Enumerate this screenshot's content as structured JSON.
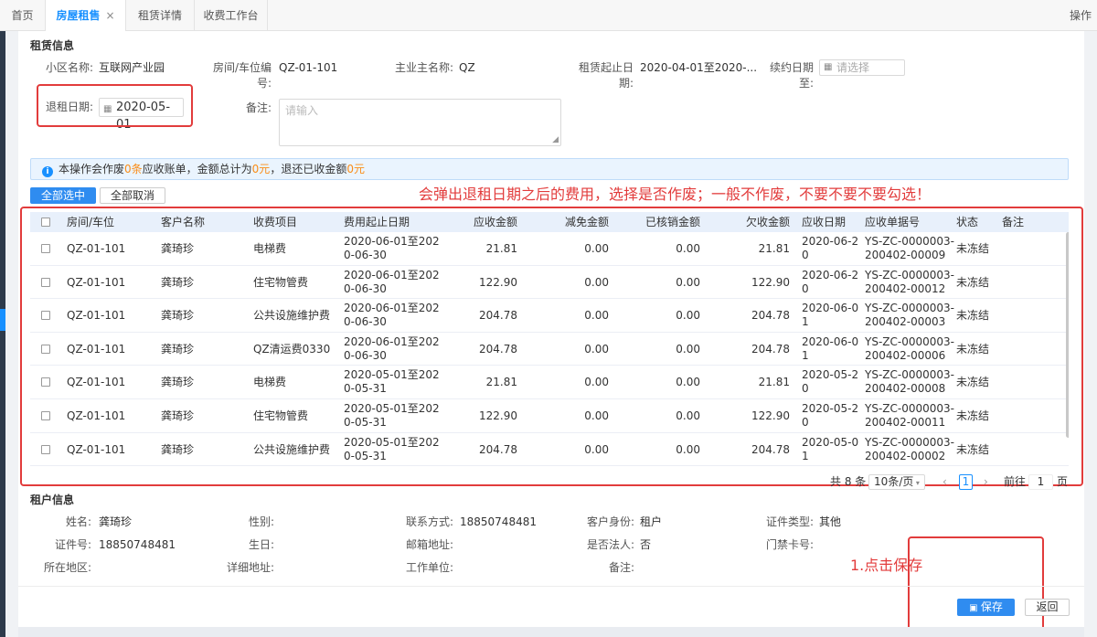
{
  "tabs": {
    "home": "首页",
    "housing": "房屋租售",
    "close": "×",
    "lease_detail": "租赁详情",
    "cashier": "收费工作台",
    "ops": "操作"
  },
  "lease": {
    "title": "租赁信息",
    "community_label": "小区名称:",
    "community_value": "互联网产业园",
    "room_label_1": "房间/车位编",
    "room_label_2": "号:",
    "room_value": "QZ-01-101",
    "owner_label": "主业主名称:",
    "owner_value": "QZ",
    "period_label_1": "租赁起止日",
    "period_label_2": "期:",
    "period_value": "2020-04-01至2020-...",
    "renew_label": "续约日期至:",
    "renew_placeholder": "请选择",
    "checkout_label": "退租日期:",
    "checkout_value": "2020-05-01",
    "remark_label": "备注:",
    "remark_placeholder": "请输入"
  },
  "alert": {
    "icon": "i",
    "p1": "本操作会作废",
    "count": "0条",
    "p2": "应收账单，金额总计为",
    "amount": "0元",
    "p3": "，退还已收金额",
    "refund": "0元"
  },
  "buttons": {
    "select_all": "全部选中",
    "cancel_all": "全部取消",
    "save": "保存",
    "back": "返回"
  },
  "annotations": {
    "top": "会弹出退租日期之后的费用，选择是否作废；一般不作废，不要不要不要勾选！",
    "save": "1.点击保存"
  },
  "table": {
    "headers": [
      "房间/车位",
      "客户名称",
      "收费项目",
      "费用起止日期",
      "应收金额",
      "减免金额",
      "已核销金额",
      "欠收金额",
      "应收日期",
      "应收单据号",
      "状态",
      "备注"
    ],
    "rows": [
      {
        "room": "QZ-01-101",
        "customer": "龚琦珍",
        "item": "电梯费",
        "period1": "2020-06-01至202",
        "period2": "0-06-30",
        "due": "21.81",
        "discount": "0.00",
        "verified": "0.00",
        "owed": "21.81",
        "date1": "2020-06-2",
        "date2": "0",
        "doc1": "YS-ZC-0000003-",
        "doc2": "200402-00009",
        "status": "未冻结"
      },
      {
        "room": "QZ-01-101",
        "customer": "龚琦珍",
        "item": "住宅物管费",
        "period1": "2020-06-01至202",
        "period2": "0-06-30",
        "due": "122.90",
        "discount": "0.00",
        "verified": "0.00",
        "owed": "122.90",
        "date1": "2020-06-2",
        "date2": "0",
        "doc1": "YS-ZC-0000003-",
        "doc2": "200402-00012",
        "status": "未冻结"
      },
      {
        "room": "QZ-01-101",
        "customer": "龚琦珍",
        "item": "公共设施维护费",
        "period1": "2020-06-01至202",
        "period2": "0-06-30",
        "due": "204.78",
        "discount": "0.00",
        "verified": "0.00",
        "owed": "204.78",
        "date1": "2020-06-0",
        "date2": "1",
        "doc1": "YS-ZC-0000003-",
        "doc2": "200402-00003",
        "status": "未冻结"
      },
      {
        "room": "QZ-01-101",
        "customer": "龚琦珍",
        "item": "QZ清运费0330",
        "period1": "2020-06-01至202",
        "period2": "0-06-30",
        "due": "204.78",
        "discount": "0.00",
        "verified": "0.00",
        "owed": "204.78",
        "date1": "2020-06-0",
        "date2": "1",
        "doc1": "YS-ZC-0000003-",
        "doc2": "200402-00006",
        "status": "未冻结"
      },
      {
        "room": "QZ-01-101",
        "customer": "龚琦珍",
        "item": "电梯费",
        "period1": "2020-05-01至202",
        "period2": "0-05-31",
        "due": "21.81",
        "discount": "0.00",
        "verified": "0.00",
        "owed": "21.81",
        "date1": "2020-05-2",
        "date2": "0",
        "doc1": "YS-ZC-0000003-",
        "doc2": "200402-00008",
        "status": "未冻结"
      },
      {
        "room": "QZ-01-101",
        "customer": "龚琦珍",
        "item": "住宅物管费",
        "period1": "2020-05-01至202",
        "period2": "0-05-31",
        "due": "122.90",
        "discount": "0.00",
        "verified": "0.00",
        "owed": "122.90",
        "date1": "2020-05-2",
        "date2": "0",
        "doc1": "YS-ZC-0000003-",
        "doc2": "200402-00011",
        "status": "未冻结"
      },
      {
        "room": "QZ-01-101",
        "customer": "龚琦珍",
        "item": "公共设施维护费",
        "period1": "2020-05-01至202",
        "period2": "0-05-31",
        "due": "204.78",
        "discount": "0.00",
        "verified": "0.00",
        "owed": "204.78",
        "date1": "2020-05-0",
        "date2": "1",
        "doc1": "YS-ZC-0000003-",
        "doc2": "200402-00002",
        "status": "未冻结"
      }
    ]
  },
  "pager": {
    "total": "共 8 条",
    "page_size": "10条/页",
    "prev": "‹",
    "current": "1",
    "next": "›",
    "goto": "前往",
    "goto_value": "1",
    "page_unit": "页"
  },
  "tenant": {
    "title": "租户信息",
    "name_label": "姓名:",
    "name_value": "龚琦珍",
    "gender_label": "性别:",
    "contact_label": "联系方式:",
    "contact_value": "18850748481",
    "identity_label": "客户身份:",
    "identity_value": "租户",
    "id_type_label": "证件类型:",
    "id_type_value": "其他",
    "id_no_label": "证件号:",
    "id_no_value": "18850748481",
    "birthday_label": "生日:",
    "mail_label": "邮箱地址:",
    "legal_label": "是否法人:",
    "legal_value": "否",
    "card_label": "门禁卡号:",
    "region_label": "所在地区:",
    "address_label": "详细地址:",
    "work_label": "工作单位:",
    "remark_label": "备注:"
  }
}
